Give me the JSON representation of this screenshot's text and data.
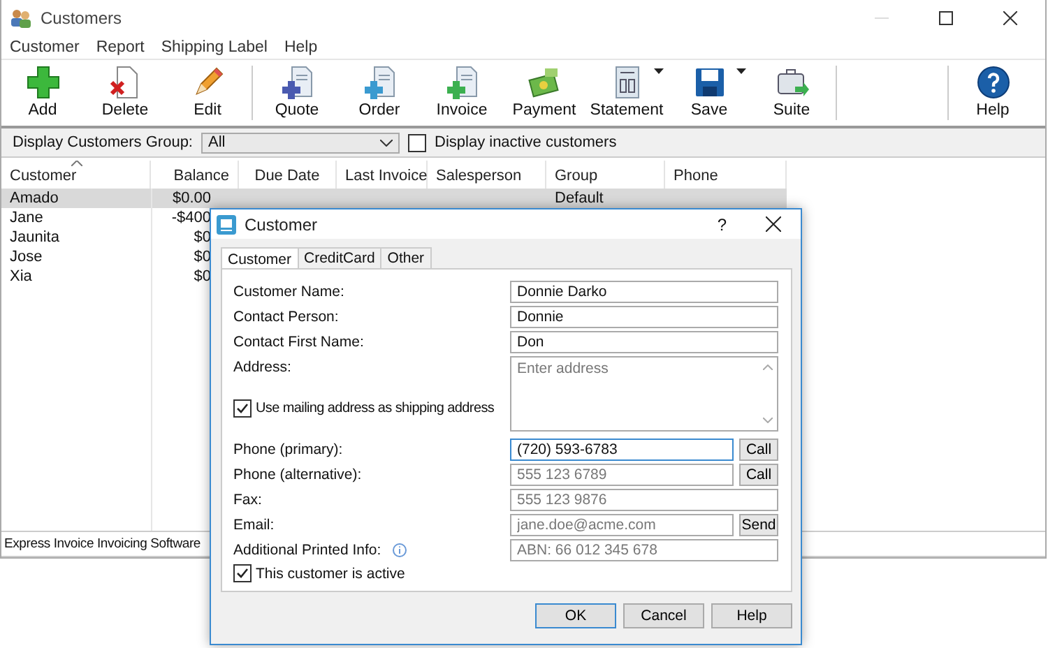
{
  "window": {
    "title": "Customers"
  },
  "menu": [
    "Customer",
    "Report",
    "Shipping Label",
    "Help"
  ],
  "toolbar": [
    {
      "label": "Add",
      "dropdown": false
    },
    {
      "label": "Delete",
      "dropdown": false
    },
    {
      "label": "Edit",
      "dropdown": false
    },
    {
      "label": "Quote",
      "dropdown": false
    },
    {
      "label": "Order",
      "dropdown": false
    },
    {
      "label": "Invoice",
      "dropdown": false
    },
    {
      "label": "Payment",
      "dropdown": false
    },
    {
      "label": "Statement",
      "dropdown": true
    },
    {
      "label": "Save",
      "dropdown": true
    },
    {
      "label": "Suite",
      "dropdown": false
    },
    {
      "label": "Help",
      "dropdown": false
    }
  ],
  "filter": {
    "label": "Display Customers Group:",
    "group_value": "All",
    "inactive": {
      "label": "Display inactive customers",
      "checked": false
    }
  },
  "table": {
    "columns": [
      {
        "label": "Customer",
        "sorted": true
      },
      {
        "label": "Balance",
        "sorted": false
      },
      {
        "label": "Due Date",
        "sorted": false
      },
      {
        "label": "Last Invoice",
        "sorted": false
      },
      {
        "label": "Salesperson",
        "sorted": false
      },
      {
        "label": "Group",
        "sorted": false
      },
      {
        "label": "Phone",
        "sorted": false
      }
    ],
    "rows": [
      {
        "selected": true,
        "cells": [
          "Amado",
          "$0.00",
          "",
          "",
          "",
          "Default",
          ""
        ]
      },
      {
        "selected": false,
        "cells": [
          "Jane",
          "-$400",
          "",
          "",
          "",
          "",
          ""
        ]
      },
      {
        "selected": false,
        "cells": [
          "Jaunita",
          "$0",
          "",
          "",
          "",
          "",
          ""
        ]
      },
      {
        "selected": false,
        "cells": [
          "Jose",
          "$0",
          "",
          "",
          "",
          "",
          ""
        ]
      },
      {
        "selected": false,
        "cells": [
          "Xia",
          "$0",
          "",
          "",
          "",
          "",
          ""
        ]
      }
    ]
  },
  "status_bar": "Express Invoice Invoicing Software",
  "dialog": {
    "title": "Customer",
    "help": "?",
    "tabs": [
      {
        "label": "Customer",
        "selected": true
      },
      {
        "label": "CreditCard",
        "selected": false
      },
      {
        "label": "Other",
        "selected": false
      }
    ],
    "fields": [
      {
        "kind": "text",
        "label": "Customer Name:",
        "value": "Donnie Darko",
        "focused": false
      },
      {
        "kind": "text",
        "label": "Contact Person:",
        "value": "Donnie",
        "focused": false
      },
      {
        "kind": "text",
        "label": "Contact First Name:",
        "value": "Don",
        "focused": false
      },
      {
        "kind": "address",
        "label": "Address:",
        "placeholder": "Enter address",
        "checkbox": {
          "label": "Use mailing address as shipping address",
          "checked": true
        }
      },
      {
        "kind": "text",
        "label": "Phone (primary):",
        "value": "(720) 593-6783",
        "button": "Call",
        "focused": true
      },
      {
        "kind": "text",
        "label": "Phone (alternative):",
        "placeholder": "555 123 6789",
        "button": "Call",
        "focused": false
      },
      {
        "kind": "text",
        "label": "Fax:",
        "placeholder": "555 123 9876",
        "focused": false
      },
      {
        "kind": "text",
        "label": "Email:",
        "placeholder": "jane.doe@acme.com",
        "button": "Send",
        "focused": false
      },
      {
        "kind": "text",
        "label": "Additional Printed Info:",
        "placeholder": "ABN: 66 012 345 678",
        "info": true,
        "focused": false
      }
    ],
    "active": {
      "label": "This customer is active",
      "checked": true
    },
    "buttons": [
      {
        "label": "OK",
        "default": true
      },
      {
        "label": "Cancel",
        "default": false
      },
      {
        "label": "Help",
        "default": false
      }
    ]
  }
}
